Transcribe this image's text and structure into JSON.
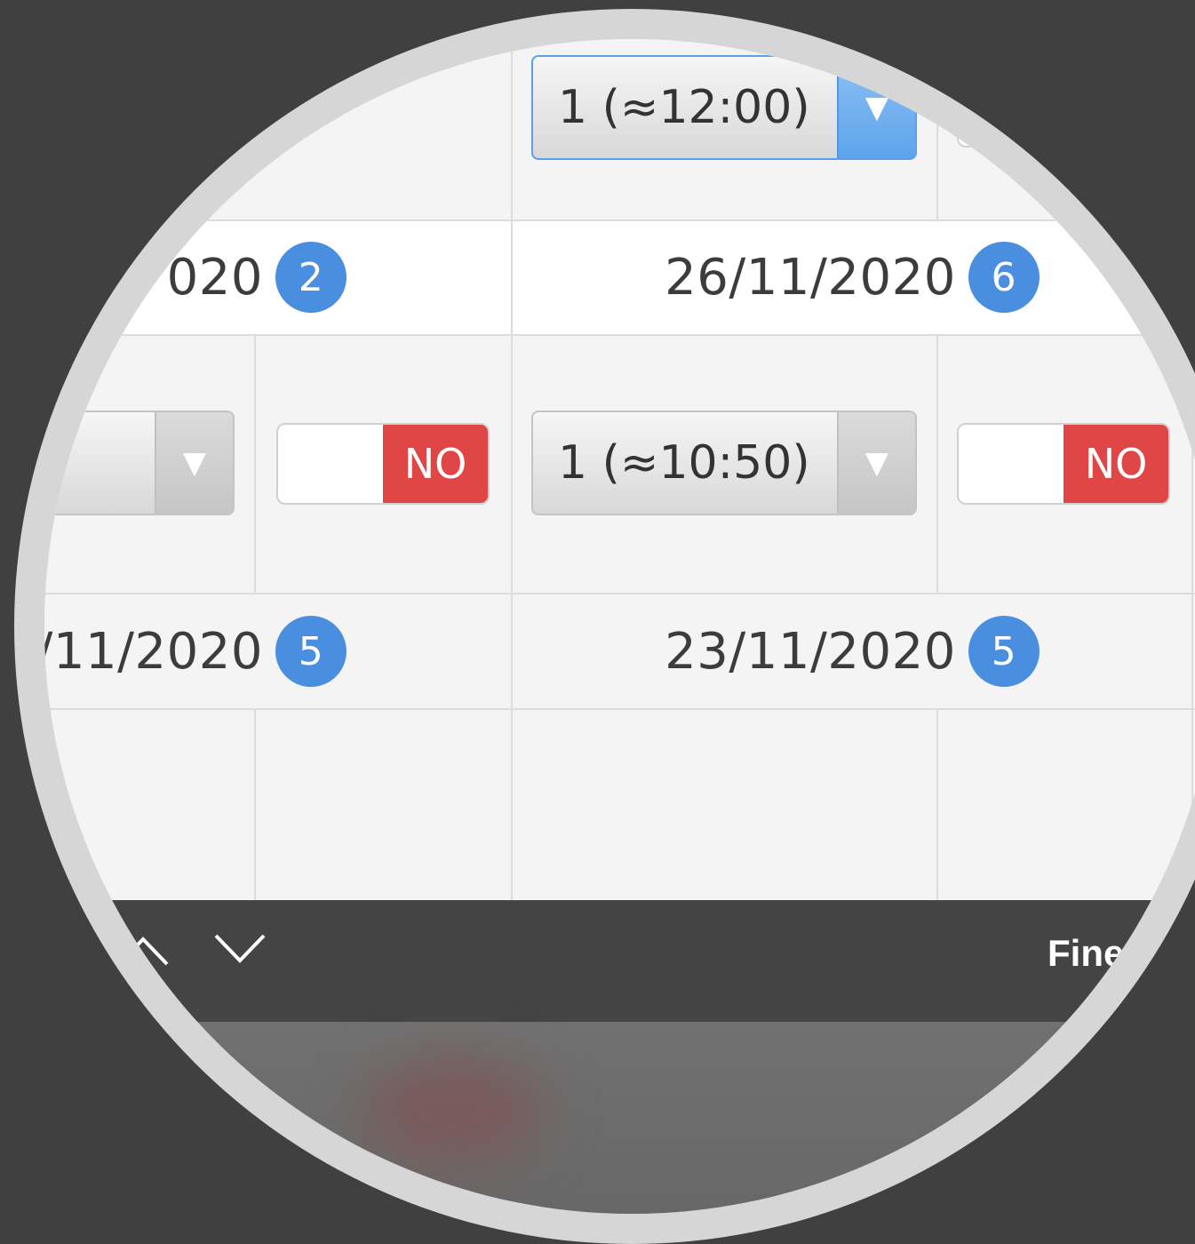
{
  "table": {
    "top_select": {
      "value": "1 (≈12:00)"
    },
    "row_dates": [
      {
        "left": "020",
        "left_badge": "2",
        "right": "26/11/2020",
        "right_badge": "6"
      },
      {
        "left": "/11/2020",
        "left_badge": "5",
        "right": "23/11/2020",
        "right_badge": "5"
      }
    ],
    "left_select": {
      "value": ""
    },
    "left_toggle": {
      "label": "NO"
    },
    "right_select": {
      "value": "1 (≈10:50)"
    },
    "right_toggle": {
      "label": "NO"
    }
  },
  "toolbar": {
    "prev_icon": "chevron-up-icon",
    "next_icon": "chevron-down-icon",
    "done_label": "Fine"
  },
  "colors": {
    "badge": "#4a8fdf",
    "toggle_no": "#e04646",
    "select_active": "#5ea4ec"
  }
}
